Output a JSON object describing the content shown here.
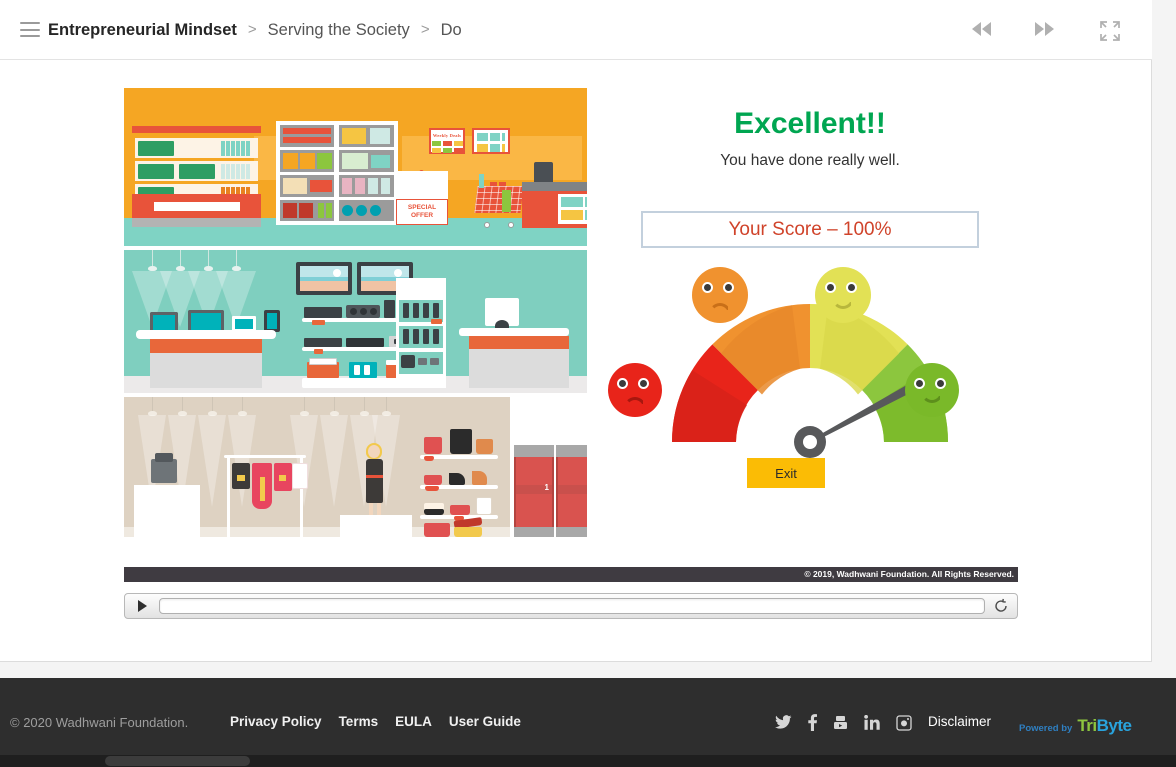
{
  "breadcrumb": {
    "root": "Entrepreneurial Mindset",
    "sep1": ">",
    "level2": "Serving the Society",
    "sep2": ">",
    "level3": "Do"
  },
  "topbar": {
    "menu_icon": "hamburger-menu-icon",
    "rewind_icon": "rewind-icon",
    "forward_icon": "fast-forward-icon",
    "fullscreen_icon": "fullscreen-icon"
  },
  "illustrations": [
    {
      "name": "grocery-store",
      "signs": {
        "weekly_deals": "Weekly Deals",
        "special_offer_line1": "SPECIAL",
        "special_offer_line2": "OFFER"
      }
    },
    {
      "name": "electronics-store"
    },
    {
      "name": "clothing-store",
      "fitting_room_number": "1"
    }
  ],
  "results": {
    "headline": "Excellent!!",
    "subline": "You have done really well.",
    "score_text": "Your Score – 100%",
    "score_value": 100,
    "exit_label": "Exit",
    "colors": {
      "headline": "#00a651",
      "score_text": "#d0432a",
      "score_border": "#c3d0dd",
      "exit_bg": "#fbbc05"
    }
  },
  "gauge": {
    "segments": [
      {
        "name": "poor",
        "color": "#e8241a",
        "face": "sad"
      },
      {
        "name": "fair",
        "color": "#f0922f",
        "face": "slightly-sad"
      },
      {
        "name": "good",
        "color": "#e2e155",
        "face": "slightly-happy"
      },
      {
        "name": "excellent",
        "color": "#8cc63e",
        "face": "happy"
      }
    ],
    "needle_points_to": "excellent",
    "needle_color": "#58595b"
  },
  "slide_footer": {
    "copyright": "© 2019, Wadhwani Foundation. All Rights Reserved."
  },
  "player": {
    "play_icon": "play-icon",
    "replay_icon": "replay-icon",
    "progress": 0
  },
  "footer": {
    "copyright": "© 2020 Wadhwani Foundation.",
    "links": [
      {
        "label": "Privacy Policy"
      },
      {
        "label": "Terms"
      },
      {
        "label": "EULA"
      },
      {
        "label": "User Guide"
      }
    ],
    "social": [
      {
        "name": "twitter-icon"
      },
      {
        "name": "facebook-icon"
      },
      {
        "name": "youtube-icon"
      },
      {
        "name": "linkedin-icon"
      },
      {
        "name": "instagram-icon"
      }
    ],
    "disclaimer": "Disclaimer",
    "powered_by": "Powered by",
    "brand_part1": "Tri",
    "brand_part2": "Byte"
  }
}
